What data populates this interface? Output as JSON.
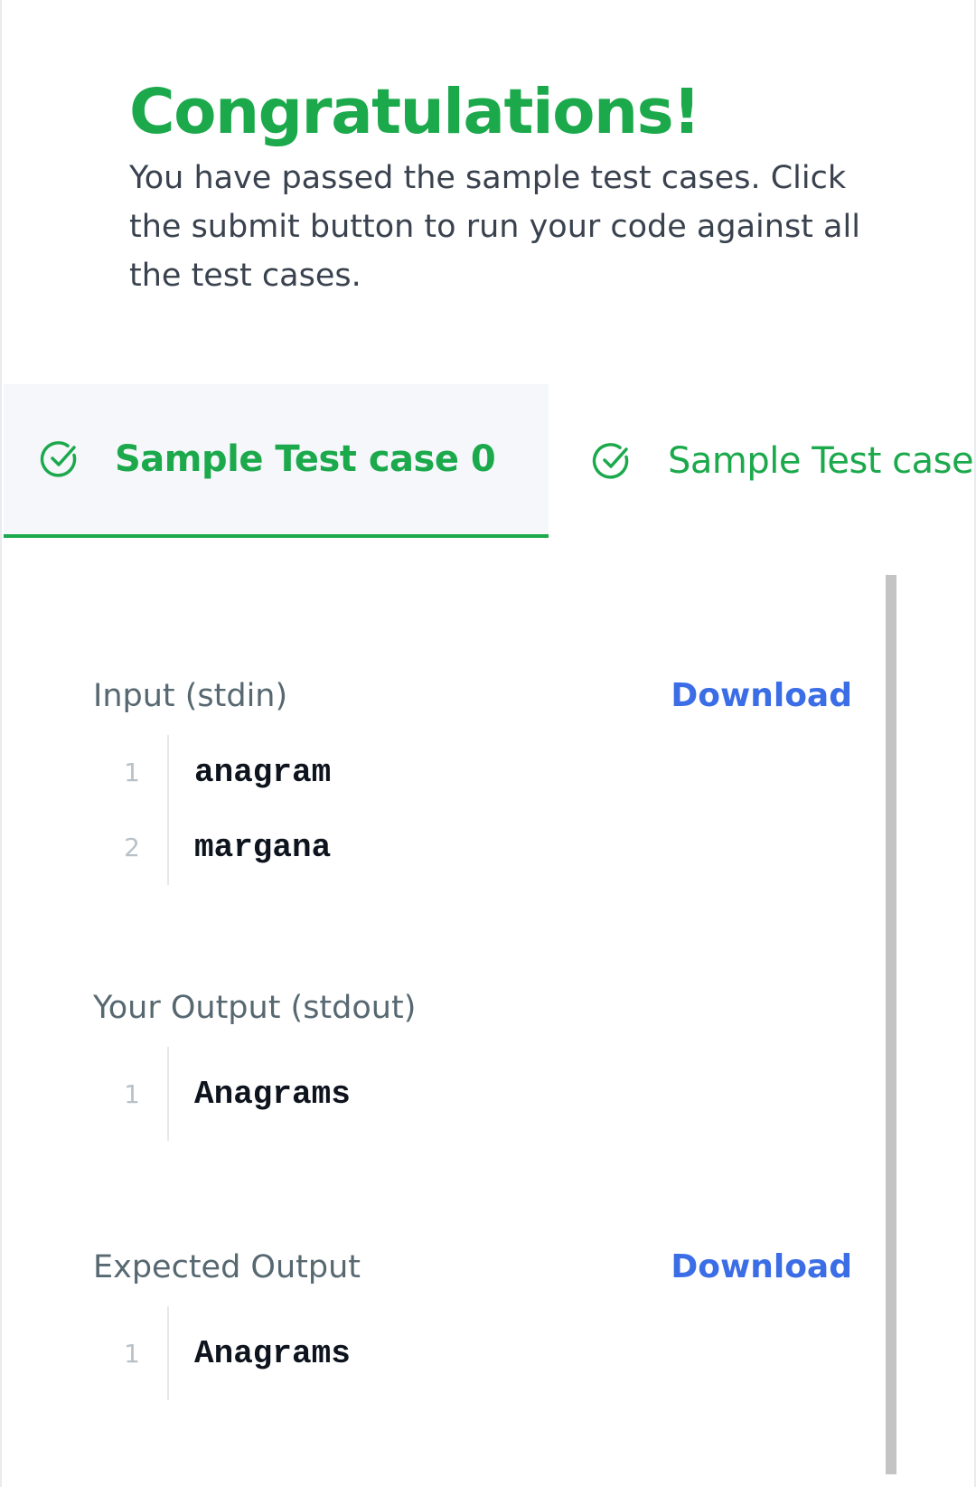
{
  "banner": {
    "title": "Congratulations!",
    "message": "You have passed the sample test cases. Click the submit button to run your code against all the test cases."
  },
  "tabs": [
    {
      "label": "Sample Test case 0",
      "active": true,
      "icon": "check-circle-icon"
    },
    {
      "label": "Sample Test case",
      "active": false,
      "icon": "check-circle-icon"
    }
  ],
  "sections": {
    "input": {
      "title": "Input (stdin)",
      "download_label": "Download",
      "lines": [
        {
          "num": "1",
          "text": "anagram"
        },
        {
          "num": "2",
          "text": "margana"
        }
      ]
    },
    "your_output": {
      "title": "Your Output (stdout)",
      "lines": [
        {
          "num": "1",
          "text": "Anagrams"
        }
      ]
    },
    "expected_output": {
      "title": "Expected Output",
      "download_label": "Download",
      "lines": [
        {
          "num": "1",
          "text": "Anagrams"
        }
      ]
    }
  },
  "colors": {
    "success_green": "#1ba94c",
    "link_blue": "#3b6de6",
    "body_text": "#39424e",
    "muted_text": "#576871",
    "tab_active_bg": "#f5f7fb"
  }
}
